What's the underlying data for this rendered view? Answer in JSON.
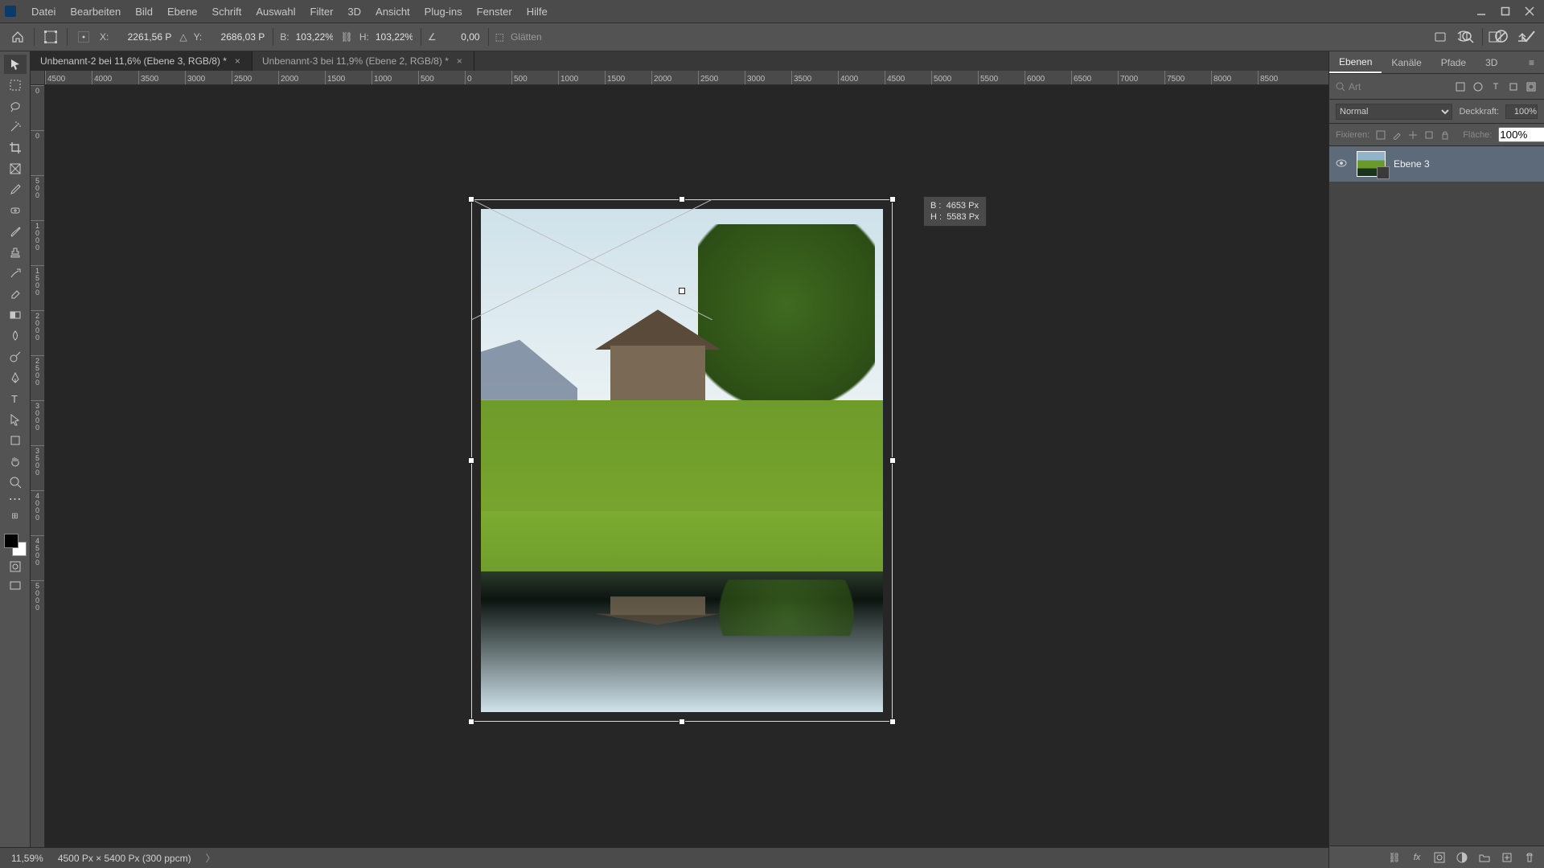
{
  "menu": {
    "items": [
      "Datei",
      "Bearbeiten",
      "Bild",
      "Ebene",
      "Schrift",
      "Auswahl",
      "Filter",
      "3D",
      "Ansicht",
      "Plug-ins",
      "Fenster",
      "Hilfe"
    ]
  },
  "options": {
    "x_label": "X:",
    "x": "2261,56 P",
    "y_label": "Y:",
    "y": "2686,03 P",
    "w_label": "B:",
    "w": "103,22%",
    "h_label": "H:",
    "h": "103,22%",
    "angle": "0,00",
    "interp": "Glätten"
  },
  "docs": [
    {
      "title": "Unbenannt-2 bei 11,6% (Ebene 3, RGB/8) *",
      "active": true
    },
    {
      "title": "Unbenannt-3 bei 11,9% (Ebene 2, RGB/8) *",
      "active": false
    }
  ],
  "ruler_h": [
    "4500",
    "4000",
    "3500",
    "3000",
    "2500",
    "2000",
    "1500",
    "1000",
    "500",
    "0",
    "500",
    "1000",
    "1500",
    "2000",
    "2500",
    "3000",
    "3500",
    "4000",
    "4500",
    "5000",
    "5500",
    "6000",
    "6500",
    "7000",
    "7500",
    "8000",
    "8500"
  ],
  "ruler_v": [
    "0",
    "0",
    "500",
    "1000",
    "1500",
    "2000",
    "2500",
    "3000",
    "3500",
    "4000",
    "4500",
    "5000"
  ],
  "tooltip": {
    "b_label": "B :",
    "b": "4653 Px",
    "h_label": "H :",
    "h": "5583 Px"
  },
  "status": {
    "zoom": "11,59%",
    "doc": "4500 Px × 5400 Px (300 ppcm)"
  },
  "panel": {
    "tabs": [
      "Ebenen",
      "Kanäle",
      "Pfade",
      "3D"
    ],
    "search_ph": "Art",
    "blend": "Normal",
    "opacity_label": "Deckkraft:",
    "opacity": "100%",
    "lock_label": "Fixieren:",
    "fill_label": "Fläche:",
    "fill": "100%",
    "layer_name": "Ebene 3"
  }
}
